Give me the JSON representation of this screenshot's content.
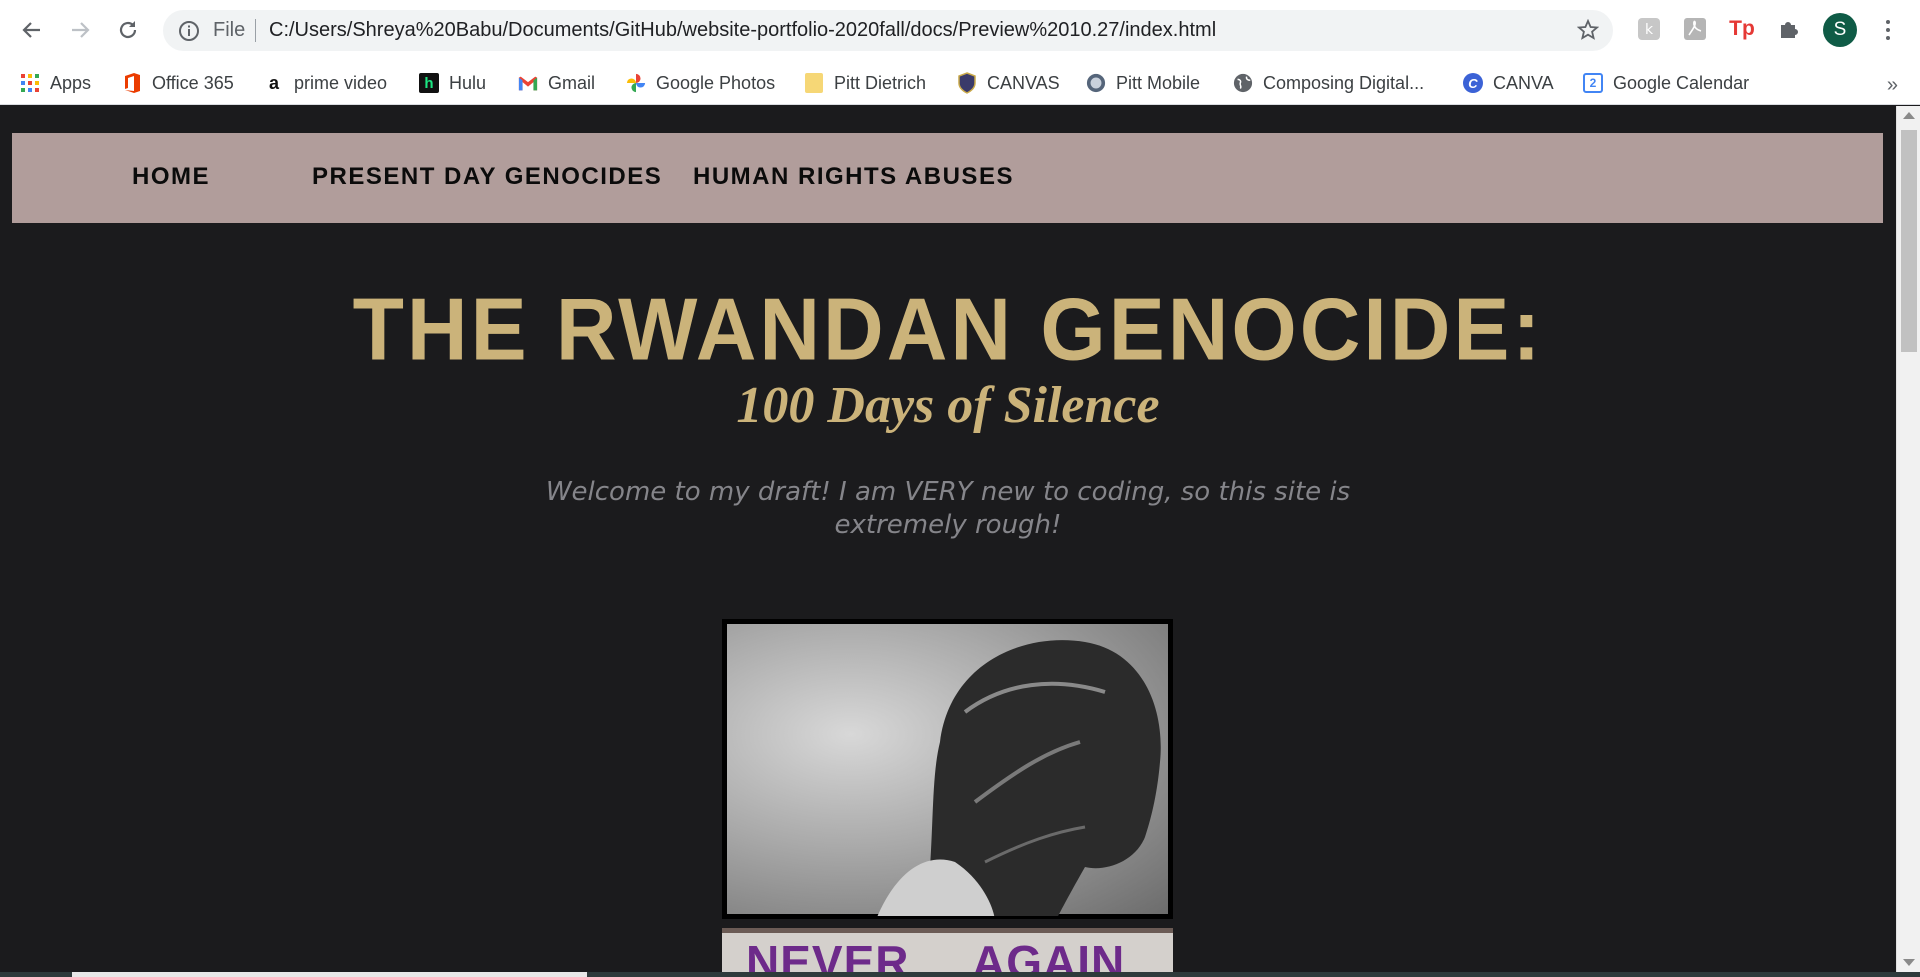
{
  "browser": {
    "file_label": "File",
    "url": "C:/Users/Shreya%20Babu/Documents/GitHub/website-portfolio-2020fall/docs/Preview%2010.27/index.html",
    "avatar_letter": "S",
    "extensions": [
      "knoji-icon",
      "pdf-icon",
      "tp-icon",
      "puzzle-icon"
    ],
    "tp_label": "Tp"
  },
  "bookmarks": {
    "items": [
      {
        "label": "Apps",
        "icon": "apps-grid-icon"
      },
      {
        "label": "Office 365",
        "icon": "office-icon"
      },
      {
        "label": "prime video",
        "icon": "amazon-icon"
      },
      {
        "label": "Hulu",
        "icon": "hulu-icon"
      },
      {
        "label": "Gmail",
        "icon": "gmail-icon"
      },
      {
        "label": "Google Photos",
        "icon": "photos-icon"
      },
      {
        "label": "Pitt Dietrich",
        "icon": "folder-icon"
      },
      {
        "label": "CANVAS",
        "icon": "shield-icon"
      },
      {
        "label": "Pitt Mobile",
        "icon": "seal-icon"
      },
      {
        "label": "Composing Digital...",
        "icon": "globe-icon"
      },
      {
        "label": "CANVA",
        "icon": "canva-icon"
      },
      {
        "label": "Google Calendar",
        "icon": "calendar-icon"
      }
    ],
    "more": "»",
    "hulu_glyph": "h",
    "amazon_glyph": "a",
    "canva_glyph": "C",
    "calendar_glyph": "2"
  },
  "site": {
    "nav": {
      "home": "HOME",
      "present": "PRESENT DAY GENOCIDES",
      "abuses": "HUMAN RIGHTS ABUSES"
    },
    "title": "THE RWANDAN GENOCIDE:",
    "subtitle": "100 Days of Silence",
    "welcome": "Welcome to my draft! I am VERY new to coding, so this site is extremely rough!",
    "banner_left": "NEVER",
    "banner_right": "AGAIN"
  },
  "colors": {
    "page_bg": "#1b1b1d",
    "nav_bg": "#b19d9b",
    "title_gold": "#cbb37a",
    "welcome_gray": "#85858a",
    "banner_purple": "#6d2a8a"
  }
}
